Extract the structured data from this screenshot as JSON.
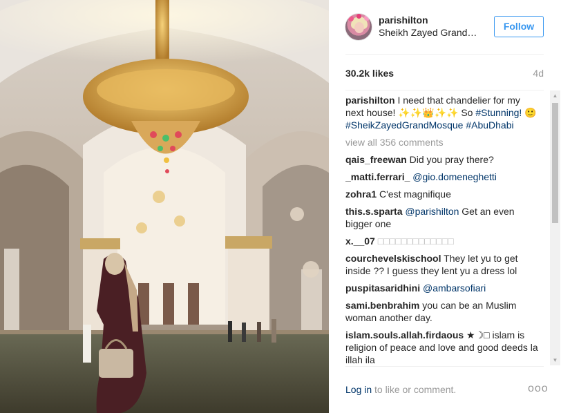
{
  "post": {
    "username": "parishilton",
    "location": "Sheikh Zayed Grand…",
    "follow_label": "Follow",
    "likes": "30.2k likes",
    "age": "4d"
  },
  "caption": {
    "username": "parishilton",
    "text_1": " I need that chandelier for my next house! ✨✨👑✨✨ So ",
    "hashtag_1": "#Stunning!",
    "text_2": " 🙂 ",
    "hashtag_2": "#SheikZayedGrandMosque",
    "text_3": " ",
    "hashtag_3": "#AbuDhabi"
  },
  "view_all_label": "view all 356 comments",
  "comments": [
    {
      "user": "qais_freewan",
      "text": " Did you pray there?",
      "mention": ""
    },
    {
      "user": "_matti.ferrari_",
      "text": " ",
      "mention": "@gio.domeneghetti"
    },
    {
      "user": "zohra1",
      "text": " C'est magnifique",
      "mention": ""
    },
    {
      "user": "this.s.sparta",
      "text": " Get an even bigger one",
      "mention": "@parishilton"
    },
    {
      "user": "x.__07",
      "text": " □□□□□□□□□□□□□",
      "mention": ""
    },
    {
      "user": "courchevelskischool",
      "text": " They let yu to get inside ?? I guess they lent yu a dress lol",
      "mention": ""
    },
    {
      "user": "puspitasaridhini",
      "text": " ",
      "mention": "@ambarsofiari"
    },
    {
      "user": "sami.benbrahim",
      "text": " you can be an Muslim woman another day.",
      "mention": ""
    },
    {
      "user": "islam.souls.allah.firdaous",
      "text": " ★☽□ islam is religion of peace and love and good deeds la illah ila",
      "mention": ""
    }
  ],
  "footer": {
    "login_link": "Log in",
    "login_rest": " to like or comment.",
    "more_icon": "ooo"
  },
  "icons": {
    "scroll_up": "▲",
    "scroll_down": "▼"
  },
  "colors": {
    "link": "#003569",
    "accent": "#3897f0",
    "muted": "#999999"
  }
}
